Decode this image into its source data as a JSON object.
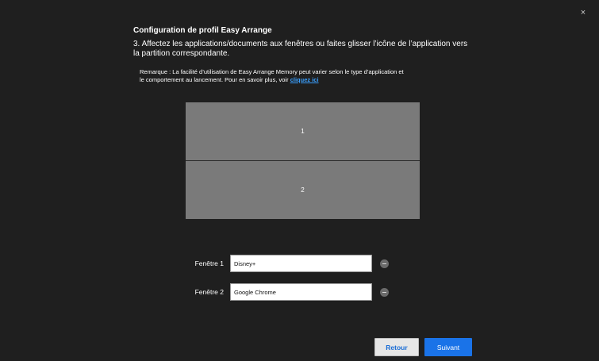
{
  "window": {
    "close_glyph": "×"
  },
  "header": {
    "title": "Configuration de profil Easy Arrange",
    "step": "3. Affectez les applications/documents aux fenêtres ou faites glisser l’icône de l’application vers la partition correspondante."
  },
  "note": {
    "text": "Remarque : La facilité d’utilisation de Easy Arrange Memory peut varier selon le type d’application et le comportement au lancement. Pour en savoir plus, voir ",
    "link_label": "cliquez ici"
  },
  "layout": {
    "partitions": [
      {
        "label": "1"
      },
      {
        "label": "2"
      }
    ]
  },
  "assignments": [
    {
      "label": "Fenêtre 1",
      "value": "Disney+"
    },
    {
      "label": "Fenêtre 2",
      "value": "Google Chrome"
    }
  ],
  "footer": {
    "back_label": "Retour",
    "next_label": "Suivant"
  },
  "colors": {
    "background": "#1f1f1f",
    "partition": "#7a7a7a",
    "accent": "#1a73e8",
    "link": "#3aa0ff"
  }
}
